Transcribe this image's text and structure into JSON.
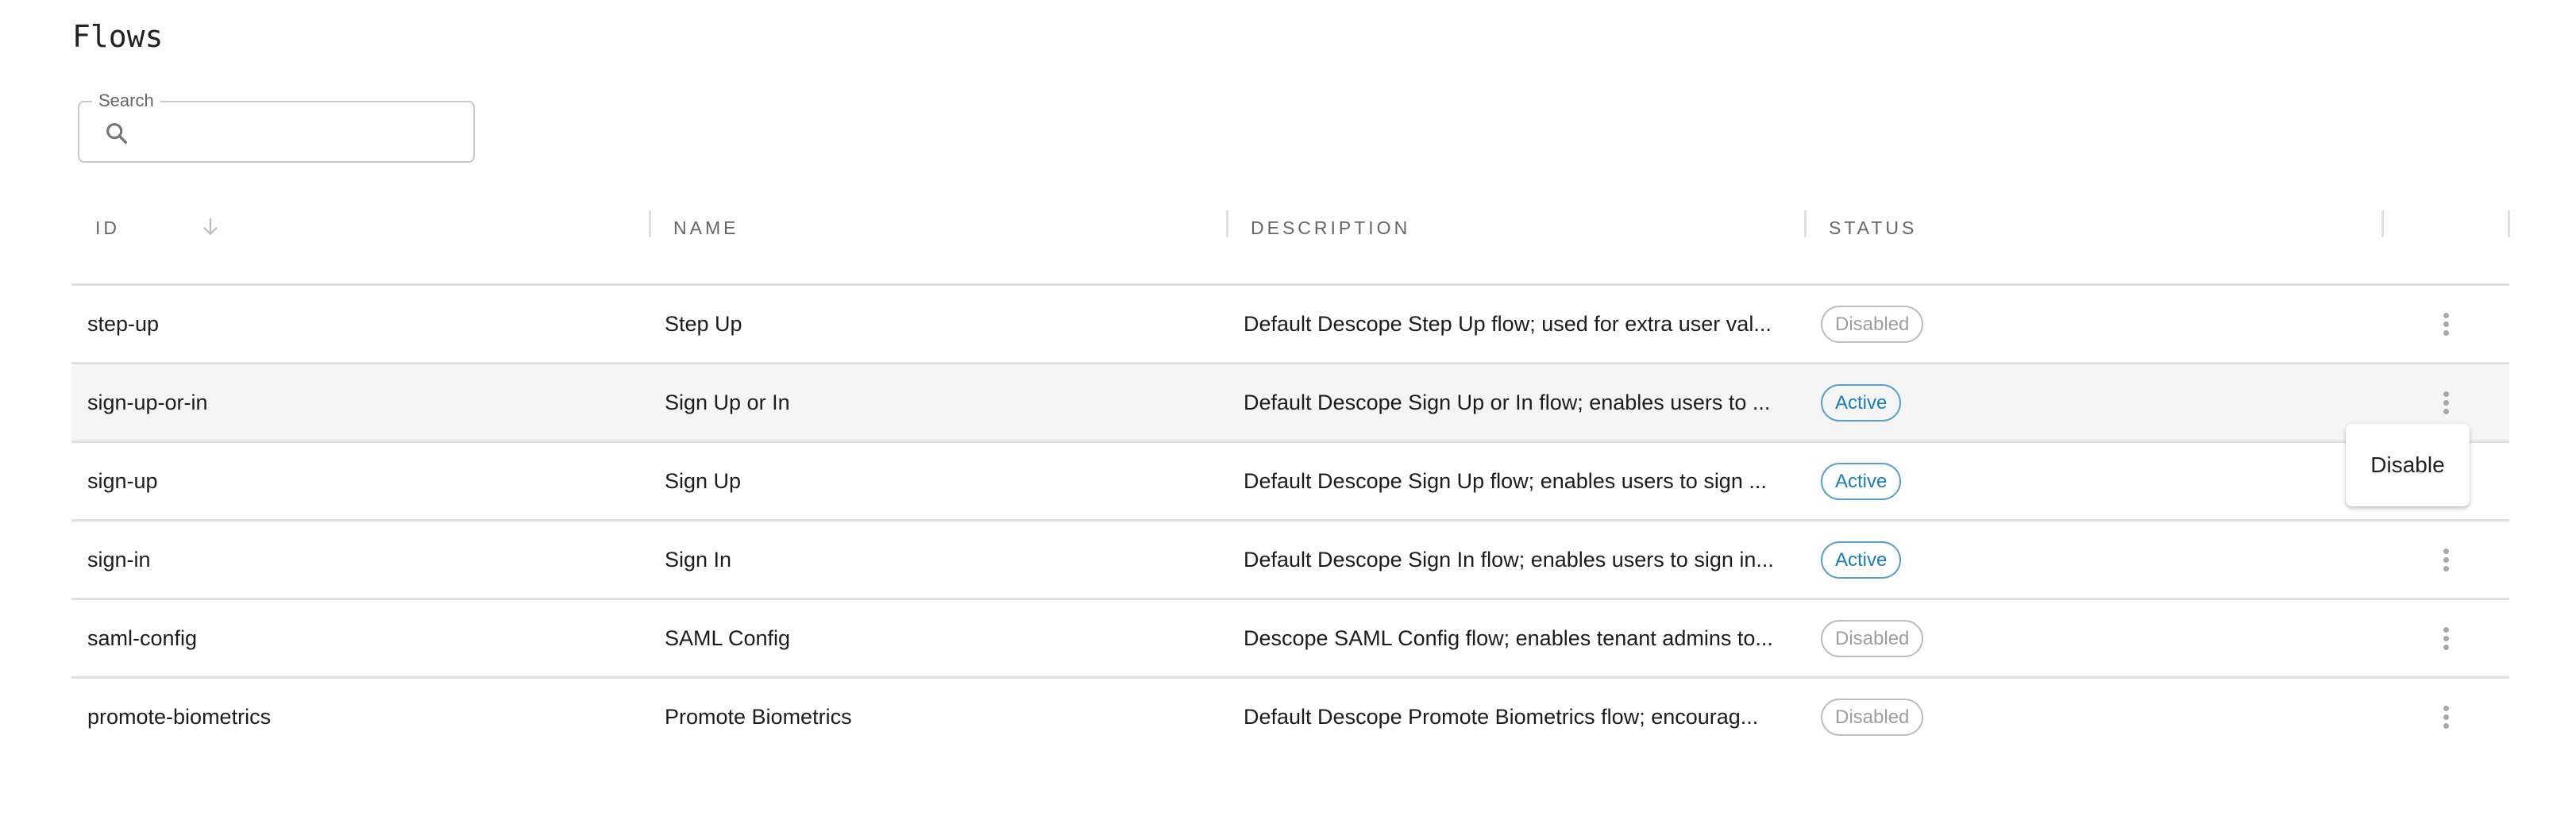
{
  "page": {
    "title": "Flows"
  },
  "search": {
    "label": "Search",
    "value": "",
    "placeholder": "",
    "icon": "search-icon"
  },
  "table": {
    "columns": [
      {
        "key": "id",
        "label": "ID",
        "sort": "descending",
        "sort_icon": "arrow-down-icon"
      },
      {
        "key": "name",
        "label": "NAME"
      },
      {
        "key": "description",
        "label": "DESCRIPTION"
      },
      {
        "key": "status",
        "label": "STATUS"
      },
      {
        "key": "actions",
        "label": ""
      }
    ],
    "rows": [
      {
        "id": "step-up",
        "name": "Step Up",
        "description": "Default Descope Step Up flow; used for extra user val...",
        "status": "Disabled",
        "hovered": false
      },
      {
        "id": "sign-up-or-in",
        "name": "Sign Up or In",
        "description": "Default Descope Sign Up or In flow; enables users to ...",
        "status": "Active",
        "hovered": true
      },
      {
        "id": "sign-up",
        "name": "Sign Up",
        "description": "Default Descope Sign Up flow; enables users to sign ...",
        "status": "Active",
        "hovered": false
      },
      {
        "id": "sign-in",
        "name": "Sign In",
        "description": "Default Descope Sign In flow; enables users to sign in...",
        "status": "Active",
        "hovered": false
      },
      {
        "id": "saml-config",
        "name": "SAML Config",
        "description": "Descope SAML Config flow; enables tenant admins to...",
        "status": "Disabled",
        "hovered": false
      },
      {
        "id": "promote-biometrics",
        "name": "Promote Biometrics",
        "description": "Default Descope Promote Biometrics flow; encourag...",
        "status": "Disabled",
        "hovered": false
      }
    ],
    "row_action_icon": "more-vertical-icon"
  },
  "context_menu": {
    "open_for_row": "sign-up-or-in",
    "items": [
      {
        "label": "Disable"
      }
    ]
  },
  "colors": {
    "active_text": "#1a7db5",
    "active_border": "#5a9fc7",
    "disabled_text": "#9e9e9e",
    "disabled_border": "#bdbdbd",
    "row_hover_bg": "#f5f5f5",
    "divider": "#e0e0e0"
  }
}
